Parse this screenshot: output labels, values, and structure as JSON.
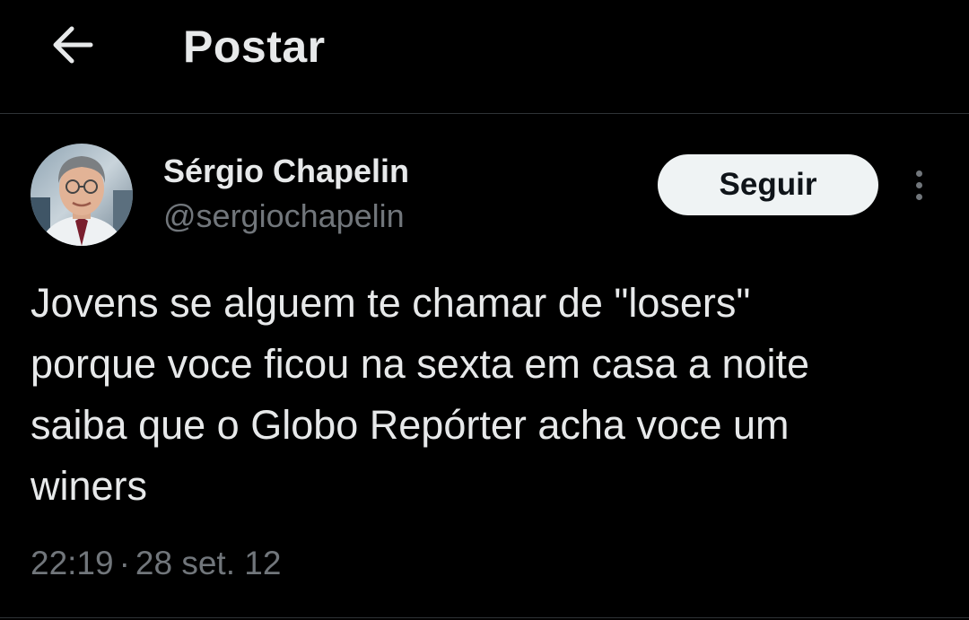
{
  "header": {
    "back_icon": "arrow-left-icon",
    "title": "Postar"
  },
  "post": {
    "author": {
      "name": "Sérgio Chapelin",
      "handle": "@sergiochapelin",
      "avatar": "profile-photo"
    },
    "follow_label": "Seguir",
    "more_icon": "vertical-ellipsis-icon",
    "text": "Jovens se alguem te chamar de \"losers\"\nporque voce ficou na sexta em casa a noite\nsaiba que o Globo Repórter acha voce um\nwiners",
    "time": "22:19",
    "separator": "·",
    "date": "28 set. 12"
  },
  "colors": {
    "background": "#000000",
    "primary_text": "#e7e9ea",
    "secondary_text": "#71767b",
    "follow_button_bg": "#eff3f4",
    "divider": "#2f3336"
  }
}
